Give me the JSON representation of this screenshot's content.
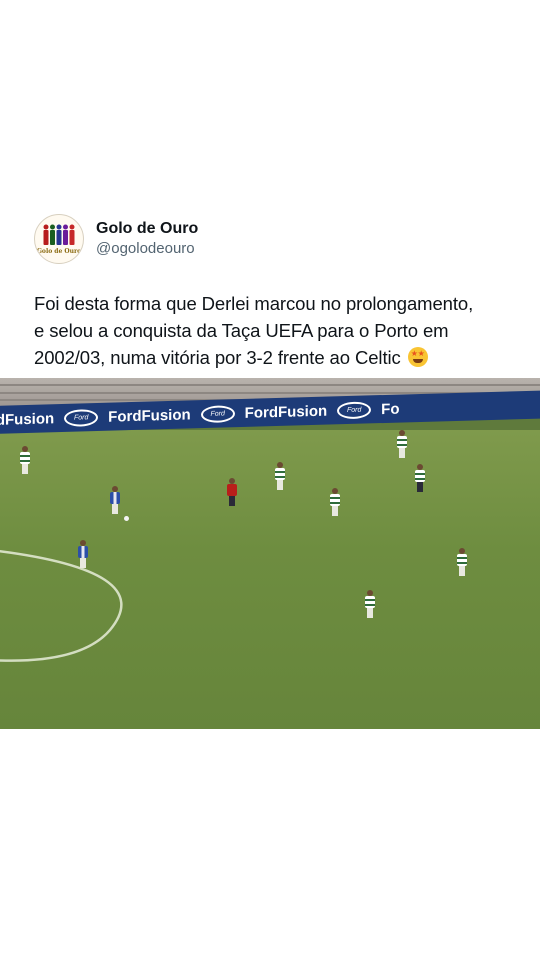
{
  "post": {
    "display_name": "Golo de Ouro",
    "handle": "@ogolodeouro",
    "avatar_text": "Golo de Ouro",
    "text_lines": [
      "Foi desta forma que Derlei marcou no prolongamento,",
      "e selou a conquista da Taça UEFA para o Porto em",
      "2002/03, numa vitória por 3-2 frente ao Celtic"
    ],
    "emoji": "star-struck-emoji"
  },
  "video": {
    "ad_board": [
      "rdFusion",
      "FordFusion",
      "FordFusion",
      "Fo"
    ],
    "ford_badge": "Ford"
  },
  "colors": {
    "text_primary": "#0f1419",
    "text_secondary": "#536471",
    "pitch_green": "#6e8d40",
    "ad_board_blue": "#1d3b78"
  }
}
